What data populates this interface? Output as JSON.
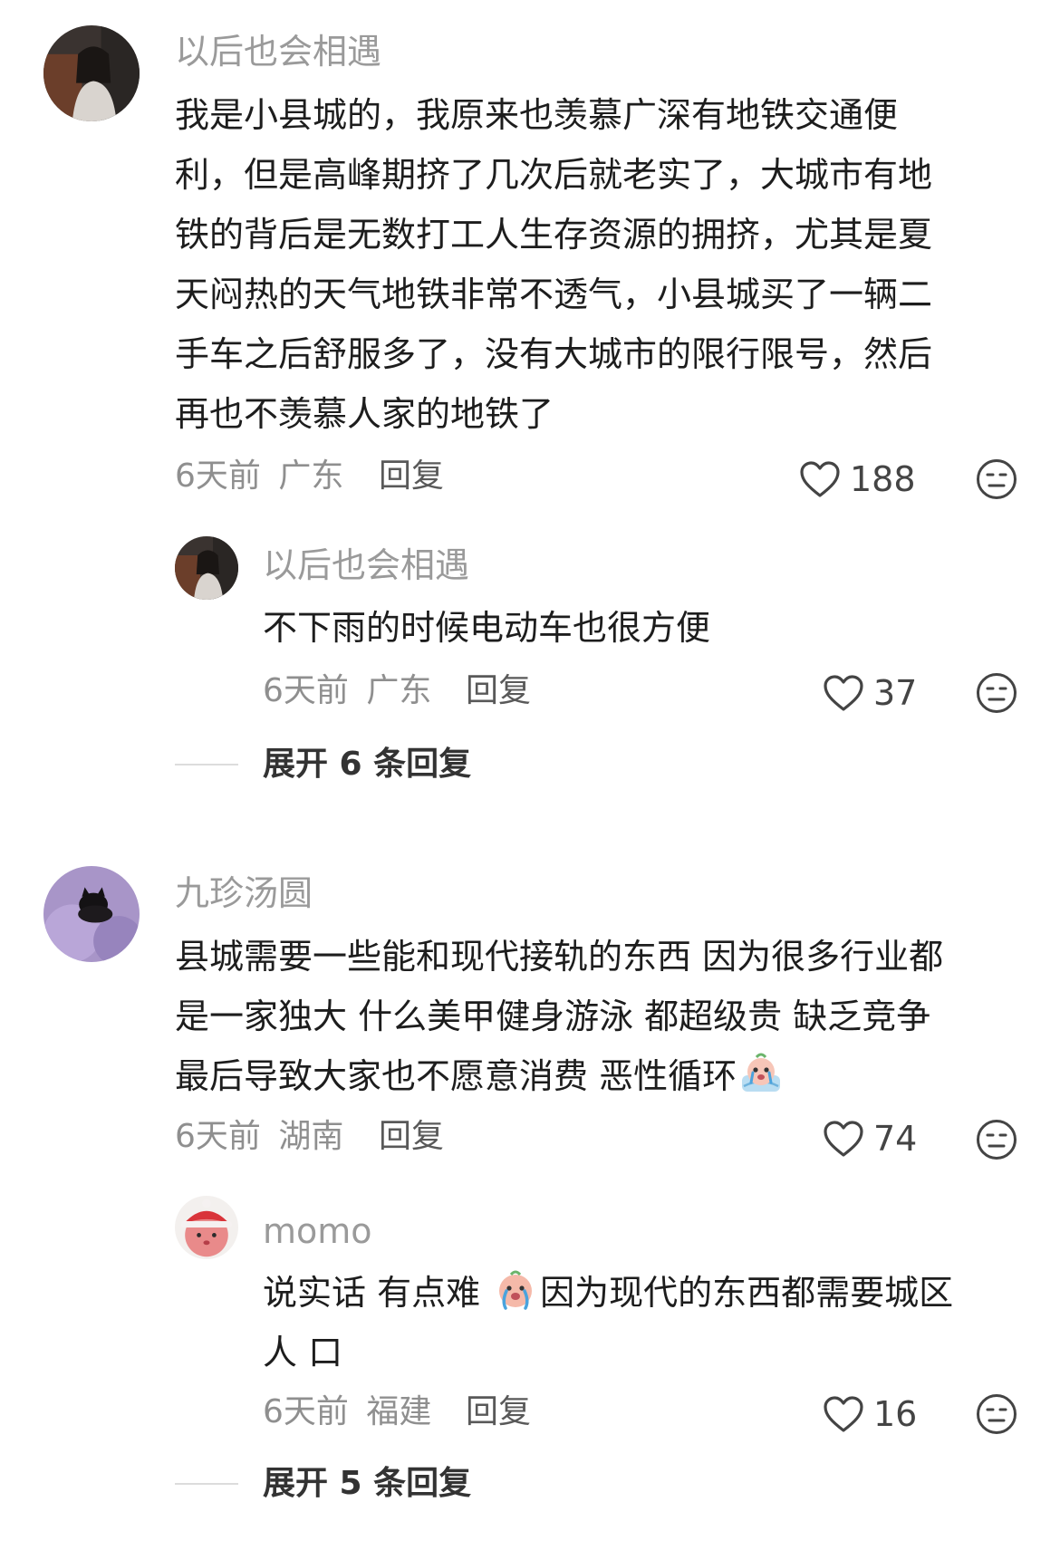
{
  "comments": [
    {
      "username": "以后也会相遇",
      "lines": [
        "我是小县城的，我原来也羡慕广深有地铁交通便",
        "利，但是高峰期挤了几次后就老实了，大城市有地",
        "铁的背后是无数打工人生存资源的拥挤，尤其是夏",
        "天闷热的天气地铁非常不透气，小县城买了一辆二",
        "手车之后舒服多了，没有大城市的限行限号，然后",
        "再也不羡慕人家的地铁了"
      ],
      "time": "6天前",
      "location": "广东",
      "reply_label": "回复",
      "likes": "188",
      "replies": [
        {
          "username": "以后也会相遇",
          "text": "不下雨的时候电动车也很方便",
          "time": "6天前",
          "location": "广东",
          "reply_label": "回复",
          "likes": "37"
        }
      ],
      "expand_label": "展开 6 条回复"
    },
    {
      "username": "九珍汤圆",
      "lines": [
        "县城需要一些能和现代接轨的东西 因为很多行业都",
        "是一家独大 什么美甲健身游泳 都超级贵 缺乏竞争",
        "最后导致大家也不愿意消费 恶性循环"
      ],
      "time": "6天前",
      "location": "湖南",
      "reply_label": "回复",
      "likes": "74",
      "replies": [
        {
          "username": "momo",
          "line1_before": "说实话 有点难 ",
          "line1_after": "因为现代的东西都需要城区",
          "line2": "人 口",
          "time": "6天前",
          "location": "福建",
          "reply_label": "回复",
          "likes": "16"
        }
      ],
      "expand_label": "展开 5 条回复"
    }
  ],
  "icons": {
    "like": "heart-outline-icon",
    "dislike": "neutral-face-icon",
    "emoji_crying": "crying-emoji-icon"
  }
}
